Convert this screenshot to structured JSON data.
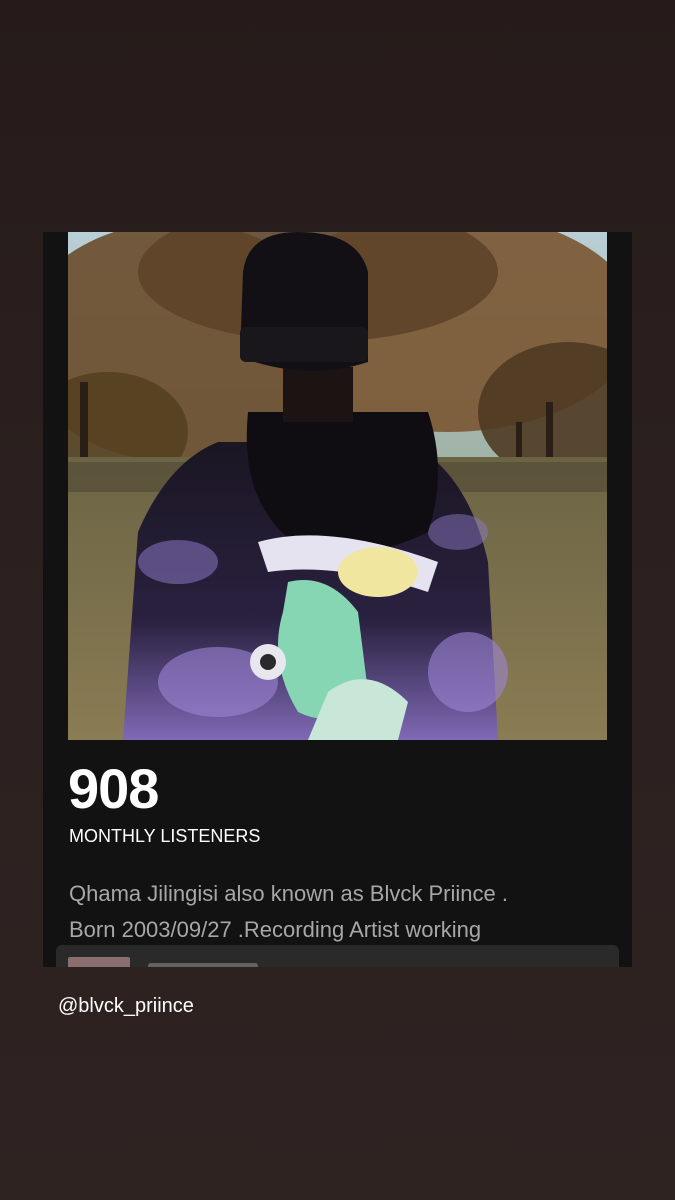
{
  "artist": {
    "monthly_listeners_count": "908",
    "monthly_listeners_label": "MONTHLY LISTENERS",
    "bio_lines": [
      "Qhama Jilingisi also known as Blvck Priince .",
      "Born 2003/09/27 .Recording Artist working"
    ]
  },
  "story": {
    "mention": "@blvck_priince"
  },
  "icons": {
    "select": "checkbox-icon"
  },
  "colors": {
    "background": "#2b201f",
    "card": "#121212",
    "bio_text": "#a7a7a7",
    "hoodie_accent": "#9d86d6"
  }
}
